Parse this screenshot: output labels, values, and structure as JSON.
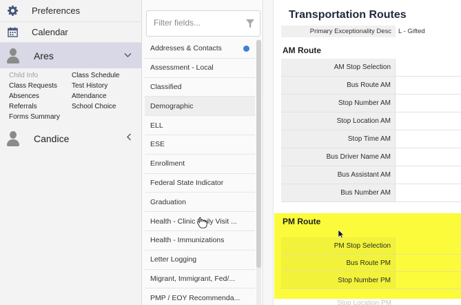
{
  "sidebar": {
    "nav": [
      {
        "label": "Preferences",
        "icon": "gear-icon"
      },
      {
        "label": "Calendar",
        "icon": "calendar-icon"
      }
    ],
    "students": [
      {
        "name": "Ares",
        "expanded": true
      },
      {
        "name": "Candice",
        "expanded": false
      }
    ],
    "sub_links": [
      "Child Info",
      "Class Schedule",
      "Class Requests",
      "Test History",
      "Absences",
      "Attendance",
      "Referrals",
      "School Choice",
      "Forms Summary"
    ]
  },
  "fields": {
    "filter_placeholder": "Filter fields...",
    "items": [
      "Addresses & Contacts",
      "Assessment - Local",
      "Classified",
      "Demographic",
      "ELL",
      "ESE",
      "Enrollment",
      "Federal State Indicator",
      "Graduation",
      "Health - Clinic Daily Visit ...",
      "Health - Immunizations",
      "Letter Logging",
      "Migrant, Immigrant, Fed/...",
      "PMP / EOY Recommenda..."
    ],
    "selected_index": 3,
    "badge_index": 0,
    "badge_color": "#3d82d6"
  },
  "detail": {
    "title": "Transportation Routes",
    "exceptionality": {
      "label": "Primary Exceptionality Desc",
      "value": "L - Gifted"
    },
    "am_title": "AM Route",
    "am_rows": [
      "AM Stop Selection",
      "Bus Route AM",
      "Stop Number AM",
      "Stop Location AM",
      "Stop Time AM",
      "Bus Driver Name AM",
      "Bus Assistant AM",
      "Bus Number AM"
    ],
    "pm_title": "PM Route",
    "pm_rows": [
      "PM Stop Selection",
      "Bus Route PM",
      "Stop Number PM"
    ],
    "pm_cutoff_row": "Stop Location PM",
    "highlight_color": "#fbfb3c"
  }
}
